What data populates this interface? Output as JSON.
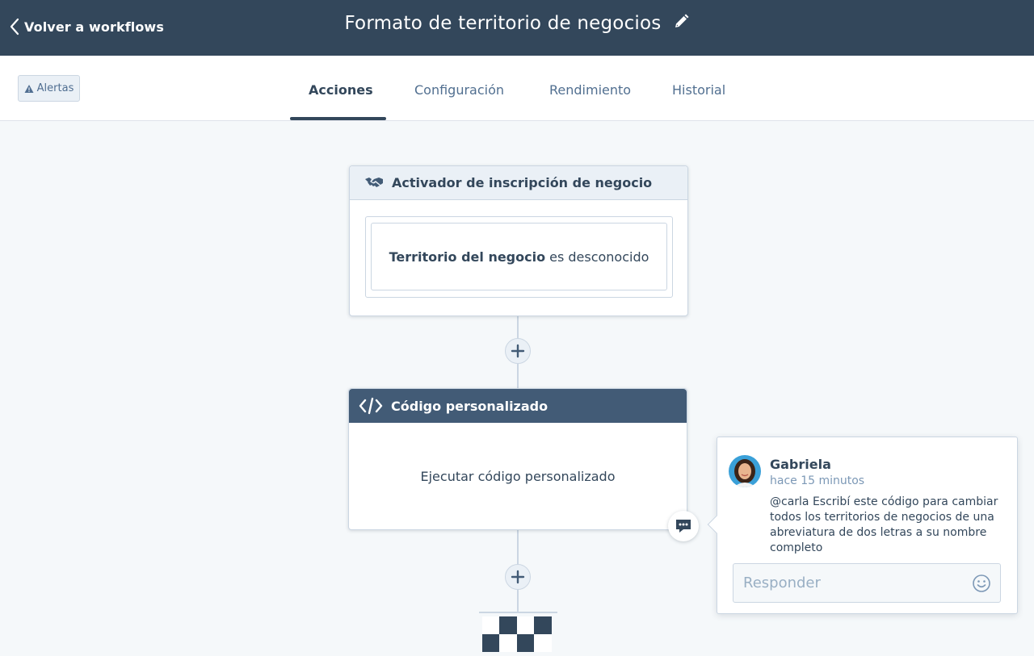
{
  "header": {
    "back_label": "Volver a workflows",
    "title": "Formato de territorio de negocios"
  },
  "toolbar": {
    "alerts_label": "Alertas"
  },
  "tabs": [
    {
      "label": "Acciones",
      "active": true
    },
    {
      "label": "Configuración",
      "active": false
    },
    {
      "label": "Rendimiento",
      "active": false
    },
    {
      "label": "Historial",
      "active": false
    }
  ],
  "trigger_card": {
    "title": "Activador de inscripción de negocio",
    "filter_property": "Territorio del negocio",
    "filter_condition": "es desconocido"
  },
  "action_card": {
    "title": "Código personalizado",
    "body": "Ejecutar código personalizado"
  },
  "comment": {
    "author": "Gabriela",
    "time": "hace 15 minutos",
    "message": "@carla Escribí este código para cambiar todos los territorios de negocios de una abreviatura de dos letras a su nombre completo",
    "reply_placeholder": "Responder"
  },
  "icons": {
    "back": "chevron-left-icon",
    "edit": "pencil-icon",
    "alerts": "warning-icon",
    "trigger": "handshake-icon",
    "code": "code-icon",
    "add": "plus-icon",
    "comment": "comment-icon",
    "emoji": "smiley-icon",
    "end": "checkered-flag-icon"
  },
  "colors": {
    "header_bg": "#33475b",
    "page_bg": "#f5f8fa",
    "action_header": "#425b76",
    "trigger_header": "#eaf0f6"
  }
}
